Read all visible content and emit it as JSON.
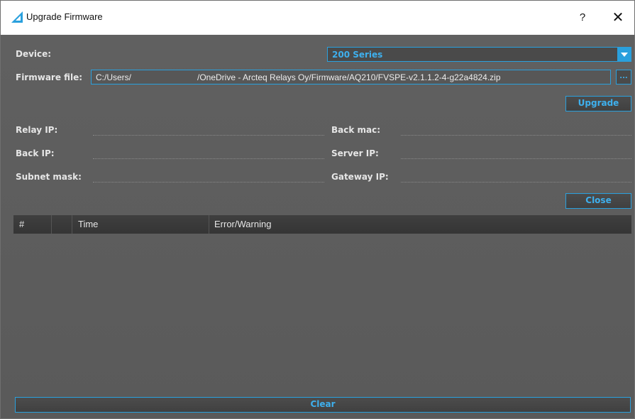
{
  "window": {
    "title": "Upgrade Firmware",
    "help": "?",
    "close": "✕",
    "accent": "#2aa0dd"
  },
  "device": {
    "label": "Device:",
    "value": "200 Series"
  },
  "firmware": {
    "label": "Firmware file:",
    "path_start": "C:/Users/",
    "path_end": "/OneDrive - Arcteq Relays Oy/Firmware/AQ210/FVSPE-v2.1.1.2-4-g22a4824.zip",
    "browse": "..."
  },
  "buttons": {
    "upgrade": "Upgrade",
    "close": "Close",
    "clear": "Clear"
  },
  "fields": {
    "relay_ip": "Relay IP:",
    "back_mac": "Back mac:",
    "back_ip": "Back IP:",
    "server_ip": "Server IP:",
    "subnet_mask": "Subnet mask:",
    "gateway_ip": "Gateway IP:"
  },
  "log": {
    "columns": [
      "#",
      "Time",
      "Error/Warning"
    ],
    "rows": []
  }
}
